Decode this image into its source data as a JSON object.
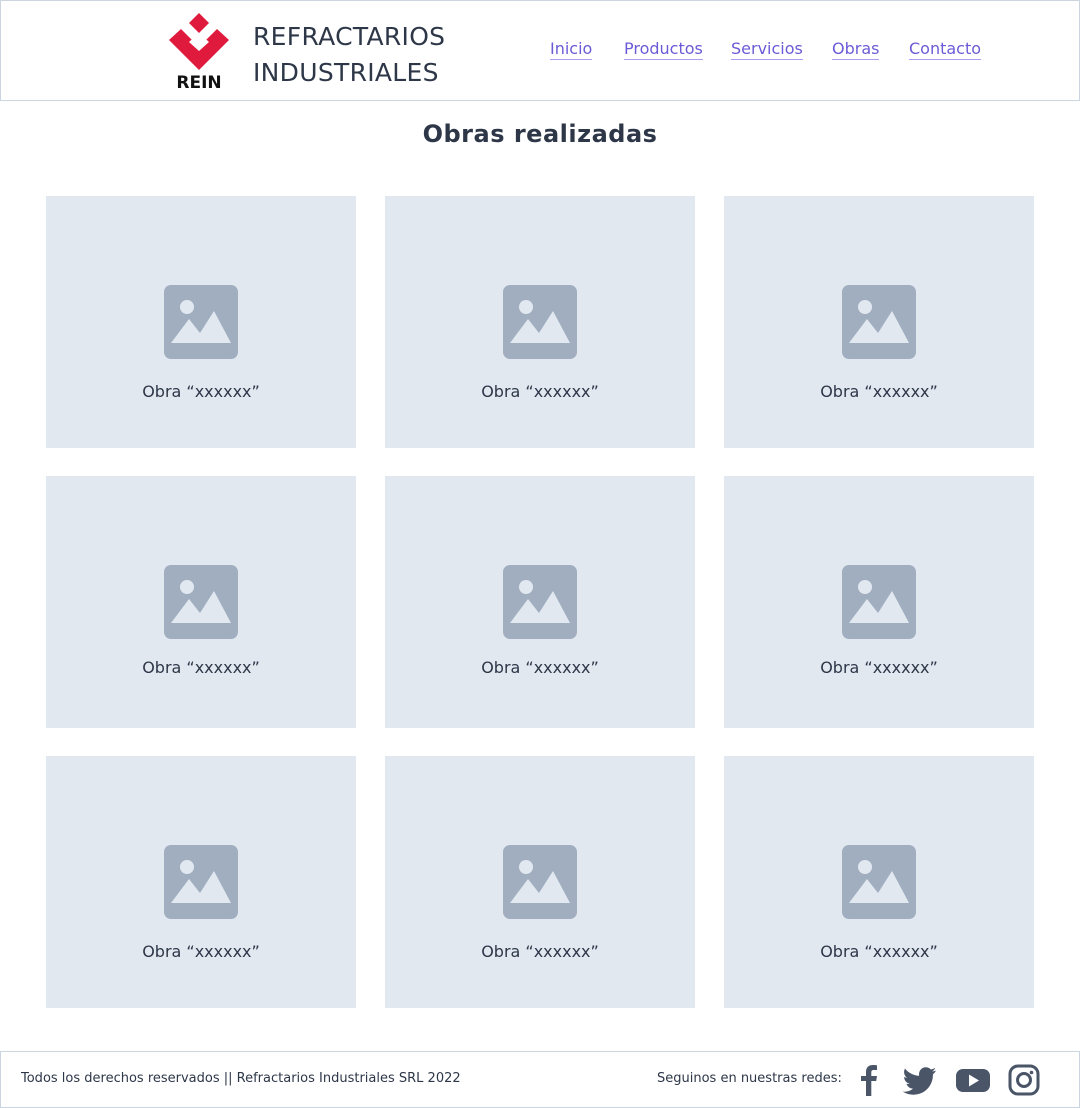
{
  "header": {
    "logo_text": "REIN",
    "brand_line1": "REFRACTARIOS",
    "brand_line2": "INDUSTRIALES",
    "nav": [
      {
        "label": "Inicio"
      },
      {
        "label": "Productos"
      },
      {
        "label": "Servicios"
      },
      {
        "label": "Obras"
      },
      {
        "label": "Contacto"
      }
    ]
  },
  "main": {
    "title": "Obras realizadas",
    "cards": [
      {
        "caption": "Obra “xxxxxx”",
        "icon": "image-placeholder-icon"
      },
      {
        "caption": "Obra “xxxxxx”",
        "icon": "image-placeholder-icon"
      },
      {
        "caption": "Obra “xxxxxx”",
        "icon": "image-placeholder-icon"
      },
      {
        "caption": "Obra “xxxxxx”",
        "icon": "image-placeholder-icon"
      },
      {
        "caption": "Obra “xxxxxx”",
        "icon": "image-placeholder-icon"
      },
      {
        "caption": "Obra “xxxxxx”",
        "icon": "image-placeholder-icon"
      },
      {
        "caption": "Obra “xxxxxx”",
        "icon": "image-placeholder-icon"
      },
      {
        "caption": "Obra “xxxxxx”",
        "icon": "image-placeholder-icon"
      },
      {
        "caption": "Obra “xxxxxx”",
        "icon": "image-placeholder-icon"
      }
    ]
  },
  "footer": {
    "copyright": "Todos los derechos reservados || Refractarios Industriales SRL 2022",
    "follow_label": "Seguinos en nuestras redes:",
    "social": [
      "facebook-icon",
      "twitter-icon",
      "youtube-icon",
      "instagram-icon"
    ]
  },
  "colors": {
    "brand_red": "#e01a3c",
    "link": "#6b5bd6",
    "card_bg": "#e2e8f0",
    "icon_gray": "#a0aec0",
    "text": "#2d3748",
    "social_icon": "#4a5568"
  }
}
